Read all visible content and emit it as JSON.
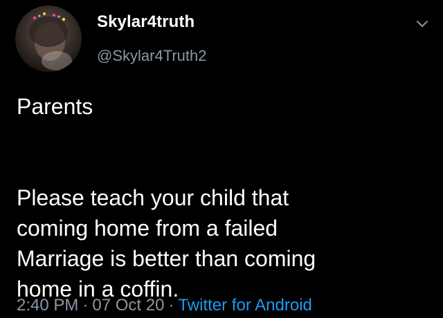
{
  "tweet": {
    "author_name": "Skylar4truth",
    "author_handle": "@Skylar4Truth2",
    "text_line1": "Parents",
    "text_body": "Please teach your child that\ncoming home from a failed\nMarriage is better than coming\nhome in a coffin.",
    "time": "2:40 PM",
    "separator": "·",
    "date": "07 Oct 20",
    "source": "Twitter for Android"
  },
  "icons": {
    "avatar": "profile-photo",
    "menu": "chevron-down-icon"
  },
  "colors": {
    "background": "#000000",
    "text": "#ffffff",
    "muted": "#8b98a5",
    "link": "#1d9bf0"
  }
}
